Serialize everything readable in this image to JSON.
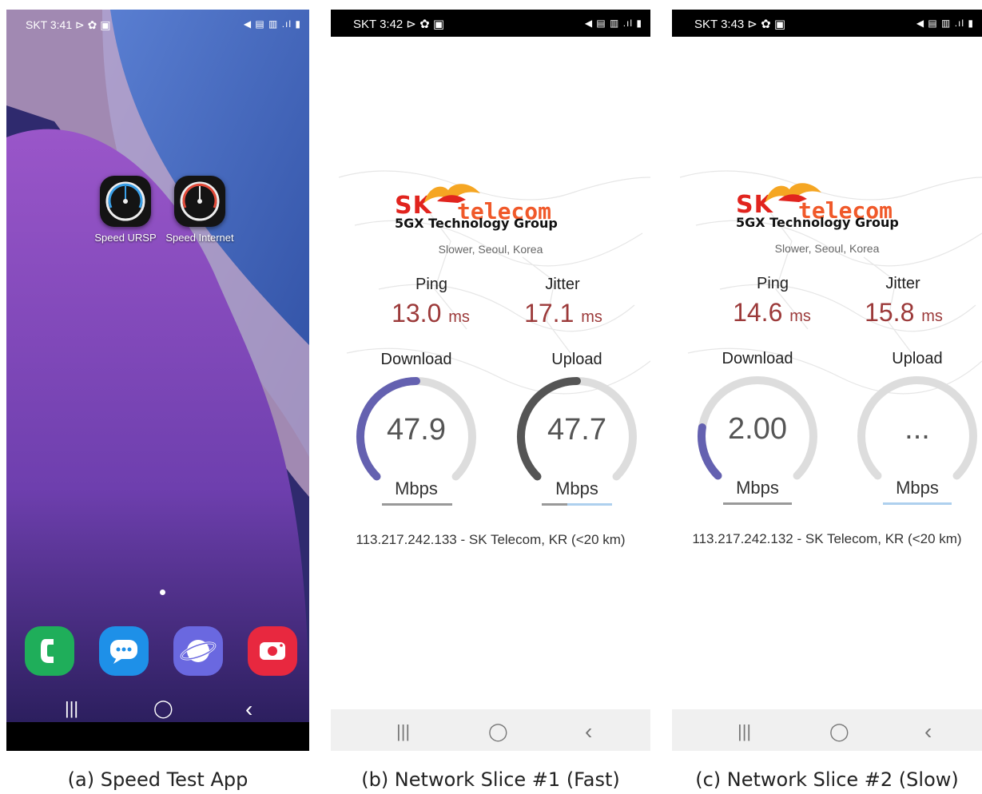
{
  "captions": [
    "(a) Speed Test App",
    "(b) Network Slice #1 (Fast)",
    "(c) Network Slice #2 (Slow)"
  ],
  "phone_a": {
    "status_left": "SKT 3:41 ⊳ ✿ ▣",
    "status_right": "◀ ▤ ▥ .ıl ▮",
    "apps": [
      {
        "label": "Speed URSP",
        "icon": "speedometer-icon"
      },
      {
        "label": "Speed Internet",
        "icon": "speedometer-icon"
      }
    ],
    "dock": [
      "phone-icon",
      "messages-icon",
      "internet-browser-icon",
      "camera-icon"
    ],
    "nav": [
      "|||",
      "◯",
      "‹"
    ]
  },
  "phones": [
    {
      "status_left": "SKT 3:42 ⊳ ✿ ▣",
      "status_right": "◀ ▤ ▥ .ıl ▮",
      "logo_sk": "SK",
      "logo_telecom": "telecom",
      "logo_sub": "5GX Technology Group",
      "server": "Slower, Seoul, Korea",
      "ping_label": "Ping",
      "ping_value": "13.0",
      "ping_unit": "ms",
      "jitter_label": "Jitter",
      "jitter_value": "17.1",
      "jitter_unit": "ms",
      "download_label": "Download",
      "download_value": "47.9",
      "download_unit": "Mbps",
      "download_fill": 0.5,
      "upload_label": "Upload",
      "upload_value": "47.7",
      "upload_unit": "Mbps",
      "upload_fill": 0.5,
      "ip": "113.217.242.133 - SK Telecom, KR (<20 km)",
      "nav": [
        "|||",
        "◯",
        "‹"
      ]
    },
    {
      "status_left": "SKT 3:43 ⊳ ✿ ▣",
      "status_right": "◀ ▤ ▥ .ıl ▮",
      "logo_sk": "SK",
      "logo_telecom": "telecom",
      "logo_sub": "5GX Technology Group",
      "server": "Slower, Seoul, Korea",
      "ping_label": "Ping",
      "ping_value": "14.6",
      "ping_unit": "ms",
      "jitter_label": "Jitter",
      "jitter_value": "15.8",
      "jitter_unit": "ms",
      "download_label": "Download",
      "download_value": "2.00",
      "download_unit": "Mbps",
      "download_fill": 0.2,
      "upload_label": "Upload",
      "upload_value": "...",
      "upload_unit": "Mbps",
      "upload_fill": 0,
      "ip": "113.217.242.132 - SK Telecom, KR (<20 km)",
      "nav": [
        "|||",
        "◯",
        "‹"
      ]
    }
  ],
  "colors": {
    "download_arc": "#6461b0",
    "upload_arc_fast": "#555555",
    "track": "#dddddd",
    "accent_line": "#aed0ee"
  }
}
